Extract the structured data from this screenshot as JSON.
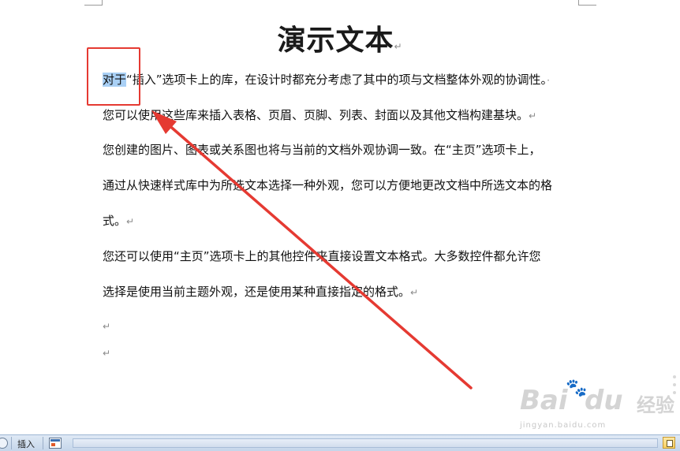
{
  "document": {
    "title": "演示文本",
    "para_mark": "↵",
    "lines": [
      {
        "pre": "",
        "sel": "对于",
        "text": "“插入”选项卡上的库，在设计时都充分考虑了其中的项与文档整体外观的协调性。",
        "mark": "·"
      },
      {
        "pre": "",
        "sel": "",
        "text": "您可以使用这些库来插入表格、页眉、页脚、列表、封面以及其他文档构建基块。",
        "mark": "↵"
      },
      {
        "pre": "",
        "sel": "",
        "text": "您创建的图片、图表或关系图也将与当前的文档外观协调一致。在“主页”选项卡上，",
        "mark": ""
      },
      {
        "pre": "",
        "sel": "",
        "text": "通过从快速样式库中为所选文本选择一种外观，您可以方便地更改文档中所选文本的格",
        "mark": ""
      },
      {
        "pre": "",
        "sel": "",
        "text": "式。",
        "mark": "↵"
      },
      {
        "pre": "",
        "sel": "",
        "text": "您还可以使用“主页”选项卡上的其他控件来直接设置文本格式。大多数控件都允许您",
        "mark": ""
      },
      {
        "pre": "",
        "sel": "",
        "text": "选择是使用当前主题外观，还是使用某种直接指定的格式。",
        "mark": "↵"
      },
      {
        "pre": "",
        "sel": "",
        "text": "",
        "mark": "↵"
      },
      {
        "pre": "",
        "sel": "",
        "text": "",
        "mark": "↵"
      }
    ]
  },
  "annotation": {
    "color": "#e53a32"
  },
  "watermark": {
    "logo": "Bai",
    "logo2": "du",
    "jingyan": "经验",
    "url": "jingyan.baidu.com"
  },
  "statusbar": {
    "mode_label": "插入",
    "view_icon": "print-layout-icon",
    "macro_icon": "macro-record-icon"
  }
}
